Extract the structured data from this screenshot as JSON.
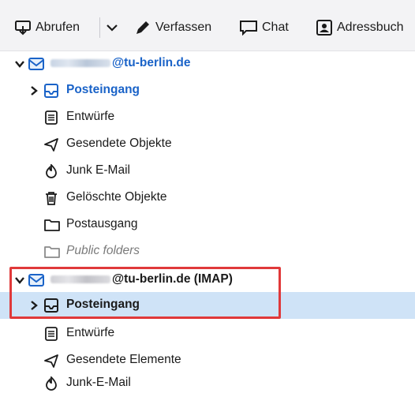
{
  "toolbar": {
    "get_messages": "Abrufen",
    "compose": "Verfassen",
    "chat": "Chat",
    "address_book": "Adressbuch"
  },
  "accounts": [
    {
      "domain": "@tu-berlin.de",
      "folders": [
        {
          "label": "Posteingang",
          "icon": "inbox-icon"
        },
        {
          "label": "Entwürfe",
          "icon": "drafts-icon"
        },
        {
          "label": "Gesendete Objekte",
          "icon": "sent-icon"
        },
        {
          "label": "Junk E-Mail",
          "icon": "junk-icon"
        },
        {
          "label": "Gelöschte Objekte",
          "icon": "trash-icon"
        },
        {
          "label": "Postausgang",
          "icon": "folder-icon"
        },
        {
          "label": "Public folders",
          "icon": "folder-icon"
        }
      ]
    },
    {
      "domain": "@tu-berlin.de (IMAP)",
      "folders": [
        {
          "label": "Posteingang",
          "icon": "inbox-icon"
        },
        {
          "label": "Entwürfe",
          "icon": "drafts-icon"
        },
        {
          "label": "Gesendete Elemente",
          "icon": "sent-icon"
        },
        {
          "label": "Junk-E-Mail",
          "icon": "junk-icon"
        }
      ]
    }
  ],
  "colors": {
    "accent_blue": "#1a63c8",
    "selection": "#cfe3f7",
    "highlight_red": "#e0393a"
  }
}
